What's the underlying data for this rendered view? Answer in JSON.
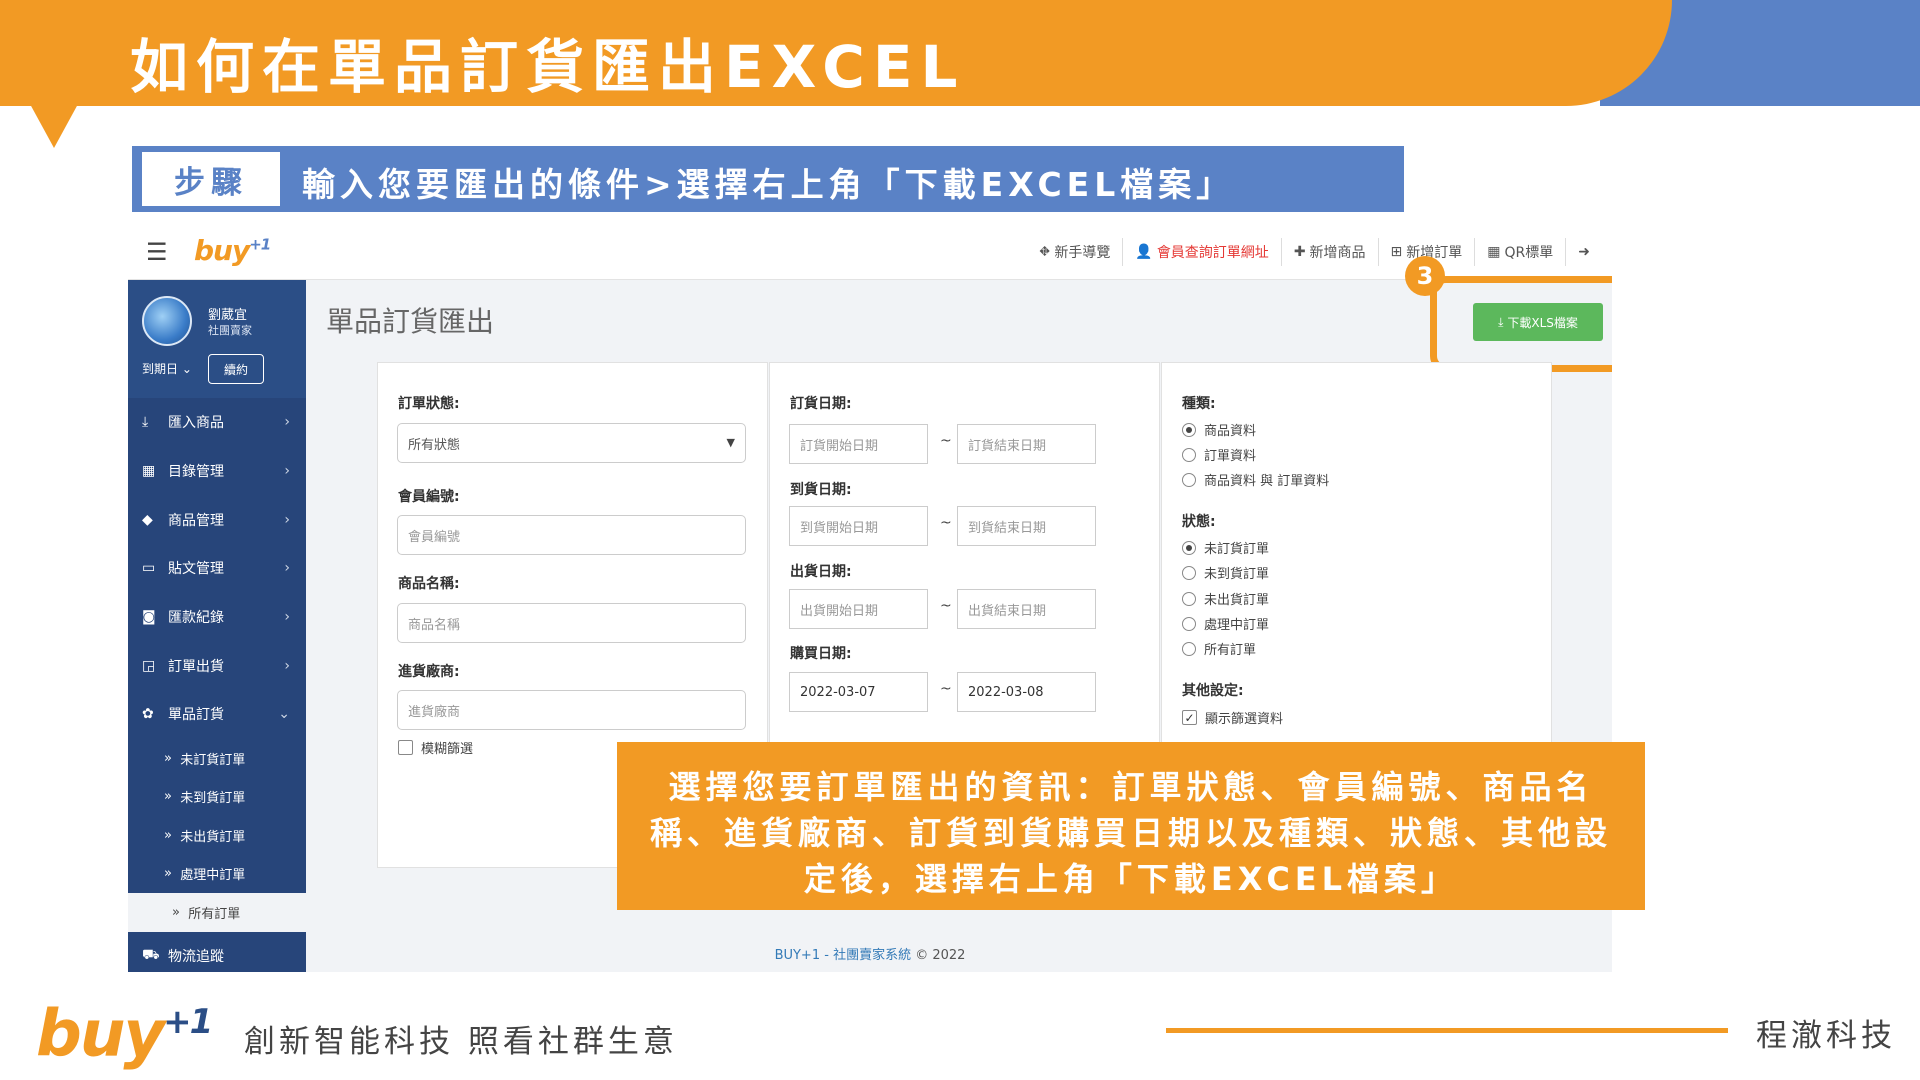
{
  "slide": {
    "title": "如何在單品訂貨匯出EXCEL",
    "step_label": "步驟",
    "step_text": "輸入您要匯出的條件>選擇右上角「下載EXCEL檔案」",
    "callout": "選擇您要訂單匯出的資訊：訂單狀態、會員編號、商品名稱、進貨廠商、訂貨到貨購買日期以及種類、狀態、其他設定後，選擇右上角「下載EXCEL檔案」",
    "step_number": "3",
    "slogan": "創新智能科技 照看社群生意",
    "company": "程澈科技",
    "brand_logo": "buy",
    "brand_logo_sup": "+1"
  },
  "app": {
    "logo": "buy",
    "logo_sup": "+1",
    "nav": [
      {
        "icon": "route-icon",
        "glyph": "⛖",
        "label": "新手導覽"
      },
      {
        "icon": "person-icon",
        "glyph": "👤",
        "label": "會員查詢訂單網址"
      },
      {
        "icon": "plus-icon",
        "glyph": "✚",
        "label": "新增商品"
      },
      {
        "icon": "plus-square-icon",
        "glyph": "⊞",
        "label": "新增訂單"
      },
      {
        "icon": "qrcode-icon",
        "glyph": "▦",
        "label": "QR標單"
      },
      {
        "icon": "logout-icon",
        "glyph": "➜",
        "label": ""
      }
    ],
    "user": {
      "name": "劉葳宜",
      "role": "社團賣家",
      "expire": "到期日",
      "renew": "續約"
    },
    "sidebar": [
      {
        "label": "匯入商品",
        "glyph": "⤓"
      },
      {
        "label": "目錄管理",
        "glyph": "▦"
      },
      {
        "label": "商品管理",
        "glyph": "◆"
      },
      {
        "label": "貼文管理",
        "glyph": "▭"
      },
      {
        "label": "匯款紀錄",
        "glyph": "◙"
      },
      {
        "label": "訂單出貨",
        "glyph": "◲"
      },
      {
        "label": "單品訂貨",
        "glyph": "✿"
      }
    ],
    "sub_items": [
      "未訂貨訂單",
      "未到貨訂單",
      "未出貨訂單",
      "處理中訂單",
      "所有訂單"
    ],
    "sidebar_last": {
      "label": "物流追蹤",
      "glyph": "⛟"
    },
    "page_title": "單品訂貨匯出",
    "download_label": "下載XLS檔案",
    "form": {
      "order_status_label": "訂單狀態:",
      "order_status_value": "所有狀態",
      "member_no_label": "會員編號:",
      "member_no_placeholder": "會員編號",
      "product_name_label": "商品名稱:",
      "product_name_placeholder": "商品名稱",
      "supplier_label": "進貨廠商:",
      "supplier_placeholder": "進貨廠商",
      "fuzzy_label": "模糊篩選",
      "order_date_label": "訂貨日期:",
      "order_date_start": "訂貨開始日期",
      "order_date_end": "訂貨結束日期",
      "arrival_date_label": "到貨日期:",
      "arrival_date_start": "到貨開始日期",
      "arrival_date_end": "到貨結束日期",
      "ship_date_label": "出貨日期:",
      "ship_date_start": "出貨開始日期",
      "ship_date_end": "出貨結束日期",
      "purchase_date_label": "購買日期:",
      "purchase_date_start": "2022-03-07",
      "purchase_date_end": "2022-03-08",
      "tilde": "~",
      "type_label": "種類:",
      "types": [
        "商品資料",
        "訂單資料",
        "商品資料 與 訂單資料"
      ],
      "status_label": "狀態:",
      "statuses": [
        "未訂貨訂單",
        "未到貨訂單",
        "未出貨訂單",
        "處理中訂單",
        "所有訂單"
      ],
      "other_label": "其他設定:",
      "show_filter_label": "顯示篩選資料"
    },
    "footer": {
      "brand": "BUY+1 - ",
      "link": "社團賣家系統",
      "copy": " © 2022"
    }
  },
  "colors": {
    "orange": "#f29a24",
    "blue": "#5a82c6",
    "sidebar": "#27457a",
    "green": "#5cb85c"
  }
}
